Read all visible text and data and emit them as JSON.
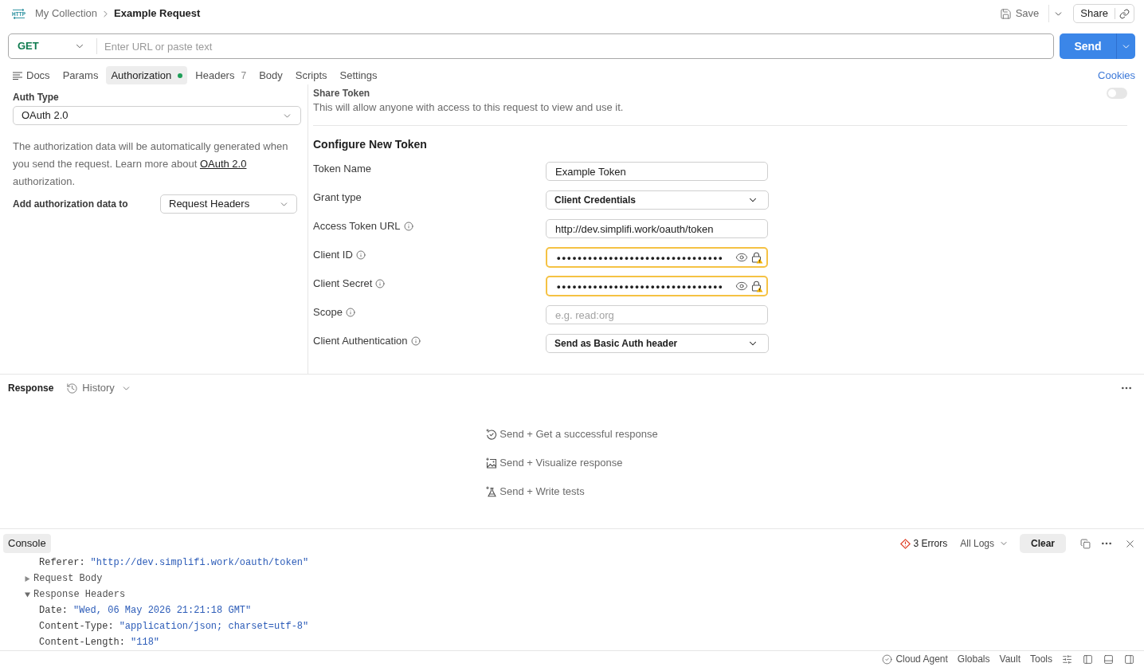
{
  "header": {
    "request_icon": "HTTP",
    "breadcrumb": "My Collection",
    "title": "Example Request",
    "save": "Save",
    "share": "Share"
  },
  "request": {
    "method": "GET",
    "url_placeholder": "Enter URL or paste text",
    "send": "Send"
  },
  "tabs": [
    {
      "label": "Docs",
      "kind": "docs",
      "selected": false,
      "configured": false
    },
    {
      "label": "Params",
      "kind": "tab",
      "selected": false,
      "configured": false
    },
    {
      "label": "Authorization",
      "kind": "tab",
      "selected": true,
      "configured": true
    },
    {
      "label": "Headers",
      "kind": "tab",
      "selected": false,
      "configured": false,
      "count": "7"
    },
    {
      "label": "Body",
      "kind": "tab",
      "selected": false,
      "configured": false
    },
    {
      "label": "Scripts",
      "kind": "tab",
      "selected": false,
      "configured": false
    },
    {
      "label": "Settings",
      "kind": "tab",
      "selected": false,
      "configured": false
    }
  ],
  "cookies": "Cookies",
  "auth": {
    "type_label": "Auth Type",
    "type_value": "OAuth 2.0",
    "description": "The authorization data will be automatically generated when you send the request. Learn more about",
    "description_link": "OAuth 2.0",
    "description_end": "authorization.",
    "add_to_label": "Add authorization data to",
    "add_to_value": "Request Headers"
  },
  "share_token": {
    "title": "Share Token",
    "description": "This will allow anyone with access to this request to view and use it.",
    "on": false
  },
  "configure_token": {
    "title": "Configure New Token",
    "fields": [
      {
        "label": "Token Name",
        "kind": "text",
        "info": false,
        "warning": false,
        "value": "Example Token"
      },
      {
        "label": "Grant type",
        "kind": "select",
        "info": false,
        "warning": false,
        "value": "Client Credentials"
      },
      {
        "label": "Access Token URL",
        "kind": "text",
        "info": true,
        "warning": false,
        "value": "http://dev.simplifi.work/oauth/token"
      },
      {
        "label": "Client ID",
        "kind": "secret",
        "info": true,
        "warning": true,
        "value": "••••••••••••••••••••••••••••••••"
      },
      {
        "label": "Client Secret",
        "kind": "secret",
        "info": true,
        "warning": true,
        "value": "••••••••••••••••••••••••••••••••"
      },
      {
        "label": "Scope",
        "kind": "text",
        "info": true,
        "warning": false,
        "placeholder": "e.g. read:org"
      },
      {
        "label": "Client Authentication",
        "kind": "select",
        "info": true,
        "warning": false,
        "value": "Send as Basic Auth header"
      }
    ]
  },
  "response": {
    "title": "Response",
    "history": "History",
    "suggestions": [
      {
        "kind": "success",
        "text": "Send + Get a successful response"
      },
      {
        "kind": "visualize",
        "text": "Send + Visualize response"
      },
      {
        "kind": "tests",
        "text": "Send + Write tests"
      }
    ]
  },
  "console": {
    "tab": "Console",
    "errors": "3 Errors",
    "filter": "All Logs",
    "clear": "Clear",
    "entries": [
      {
        "kind": "field",
        "key": "Referer:",
        "value": "\"http://dev.simplifi.work/oauth/token\""
      },
      {
        "kind": "group",
        "label": "Request Body",
        "expanded": false
      },
      {
        "kind": "group",
        "label": "Response Headers",
        "expanded": true,
        "children": [
          {
            "kind": "field",
            "key": "Date:",
            "value": "\"Wed, 06 May 2026 21:21:18 GMT\""
          },
          {
            "kind": "field",
            "key": "Content-Type:",
            "value": "\"application/json; charset=utf-8\""
          },
          {
            "kind": "field",
            "key": "Content-Length:",
            "value": "\"118\""
          }
        ]
      }
    ]
  },
  "status_bar": {
    "items": [
      {
        "kind": "agent",
        "label": "Cloud Agent"
      },
      {
        "kind": "text",
        "label": "Globals"
      },
      {
        "kind": "text",
        "label": "Vault"
      },
      {
        "kind": "text",
        "label": "Tools"
      }
    ]
  }
}
